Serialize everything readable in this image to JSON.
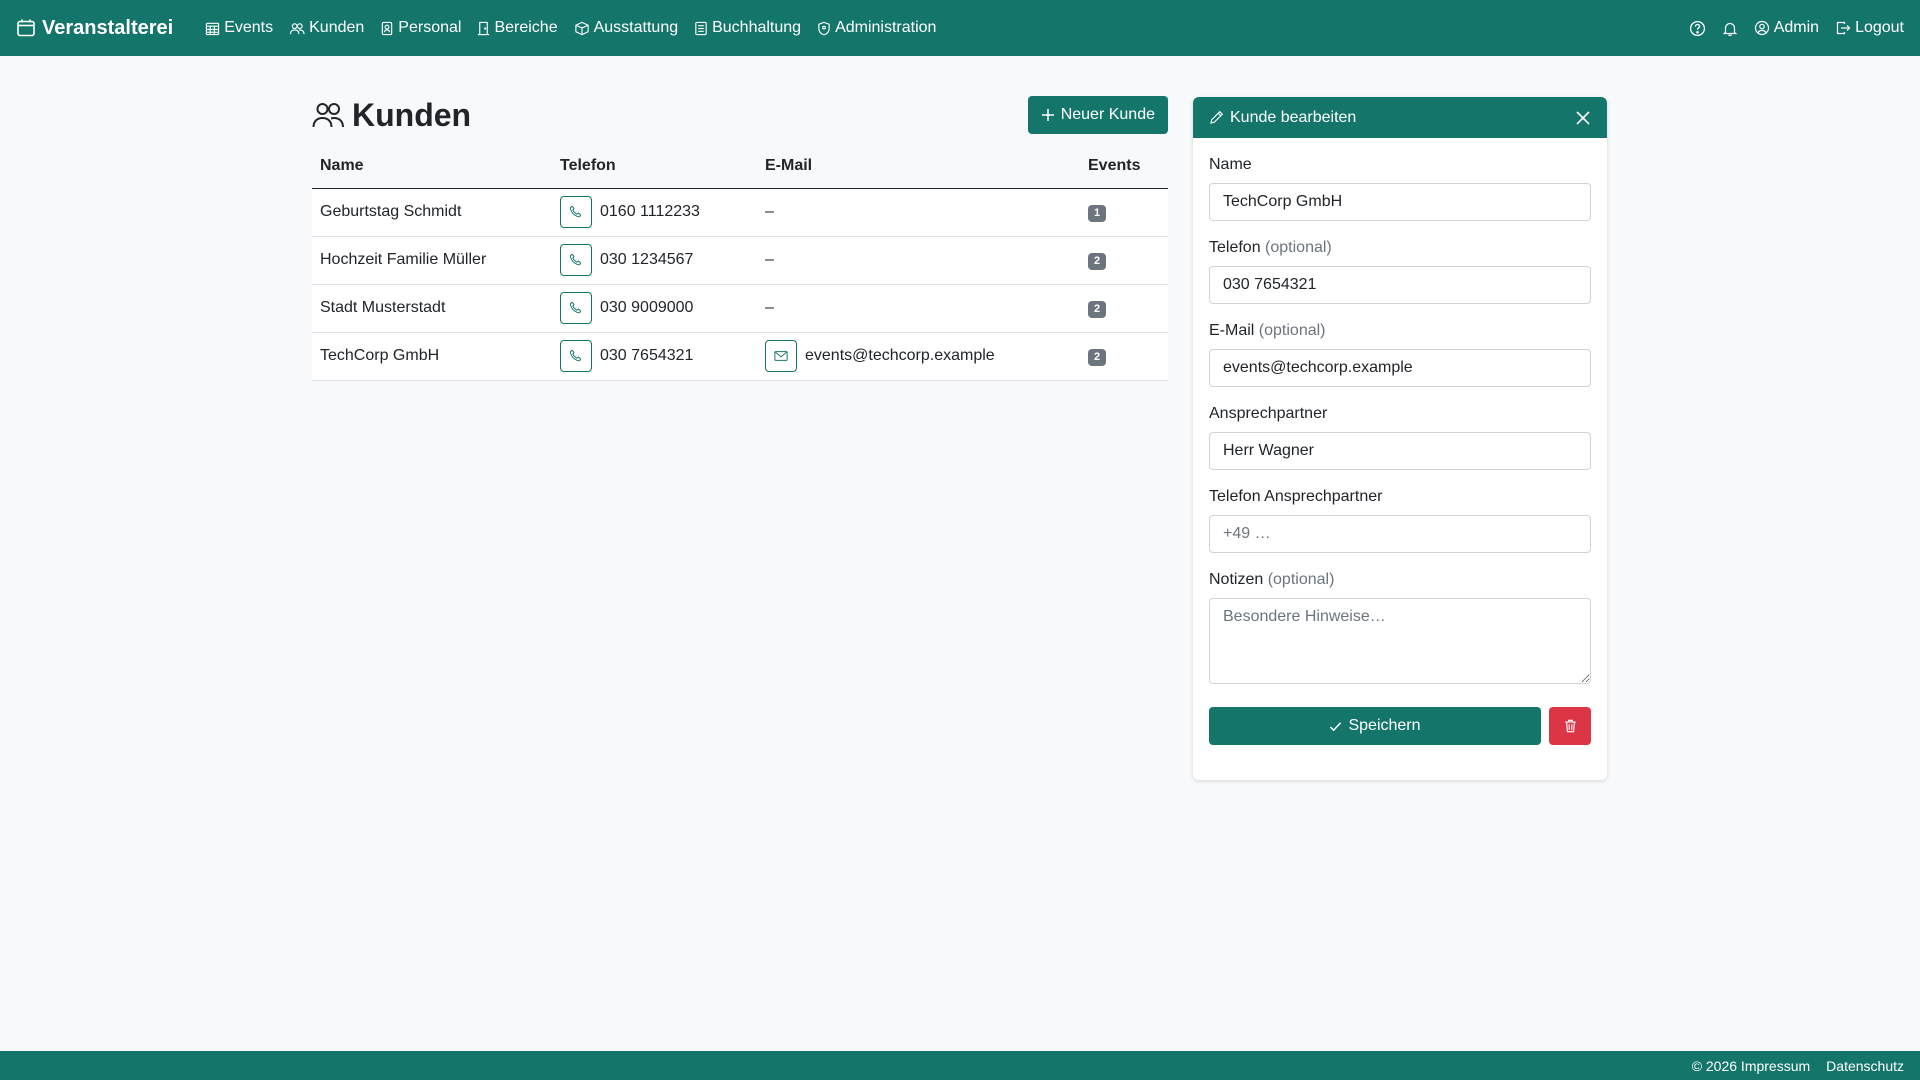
{
  "navbar": {
    "brand": "Veranstalterei",
    "items": [
      {
        "label": "Events",
        "icon": "calendar-grid-icon"
      },
      {
        "label": "Kunden",
        "icon": "people-icon"
      },
      {
        "label": "Personal",
        "icon": "badge-icon"
      },
      {
        "label": "Bereiche",
        "icon": "door-icon"
      },
      {
        "label": "Ausstattung",
        "icon": "box-icon"
      },
      {
        "label": "Buchhaltung",
        "icon": "ledger-icon"
      },
      {
        "label": "Administration",
        "icon": "shield-icon"
      }
    ],
    "user_label": "Admin",
    "logout_label": "Logout"
  },
  "page": {
    "title": "Kunden",
    "new_button": "Neuer Kunde"
  },
  "table": {
    "headers": [
      "Name",
      "Telefon",
      "E-Mail",
      "Events"
    ],
    "rows": [
      {
        "name": "Geburtstag Schmidt",
        "phone": "0160 1112233",
        "email": "–",
        "events": "1"
      },
      {
        "name": "Hochzeit Familie Müller",
        "phone": "030 1234567",
        "email": "–",
        "events": "2"
      },
      {
        "name": "Stadt Musterstadt",
        "phone": "030 9009000",
        "email": "–",
        "events": "2"
      },
      {
        "name": "TechCorp GmbH",
        "phone": "030 7654321",
        "email": "events@techcorp.example",
        "events": "2"
      }
    ]
  },
  "panel": {
    "title": "Kunde bearbeiten",
    "optional": "(optional)",
    "name_label": "Name",
    "name_value": "TechCorp GmbH",
    "phone_label": "Telefon",
    "phone_value": "030 7654321",
    "email_label": "E-Mail",
    "email_value": "events@techcorp.example",
    "contact_label": "Ansprechpartner",
    "contact_value": "Herr Wagner",
    "contact_phone_label": "Telefon Ansprechpartner",
    "contact_phone_placeholder": "+49 …",
    "notes_label": "Notizen",
    "notes_placeholder": "Besondere Hinweise…",
    "save_label": "Speichern"
  },
  "footer": {
    "impressum": "© 2026 Impressum",
    "datenschutz": "Datenschutz"
  },
  "colors": {
    "primary": "#14756b",
    "danger": "#dc3545",
    "badge": "#6c757d",
    "background": "#f7f9fa"
  }
}
